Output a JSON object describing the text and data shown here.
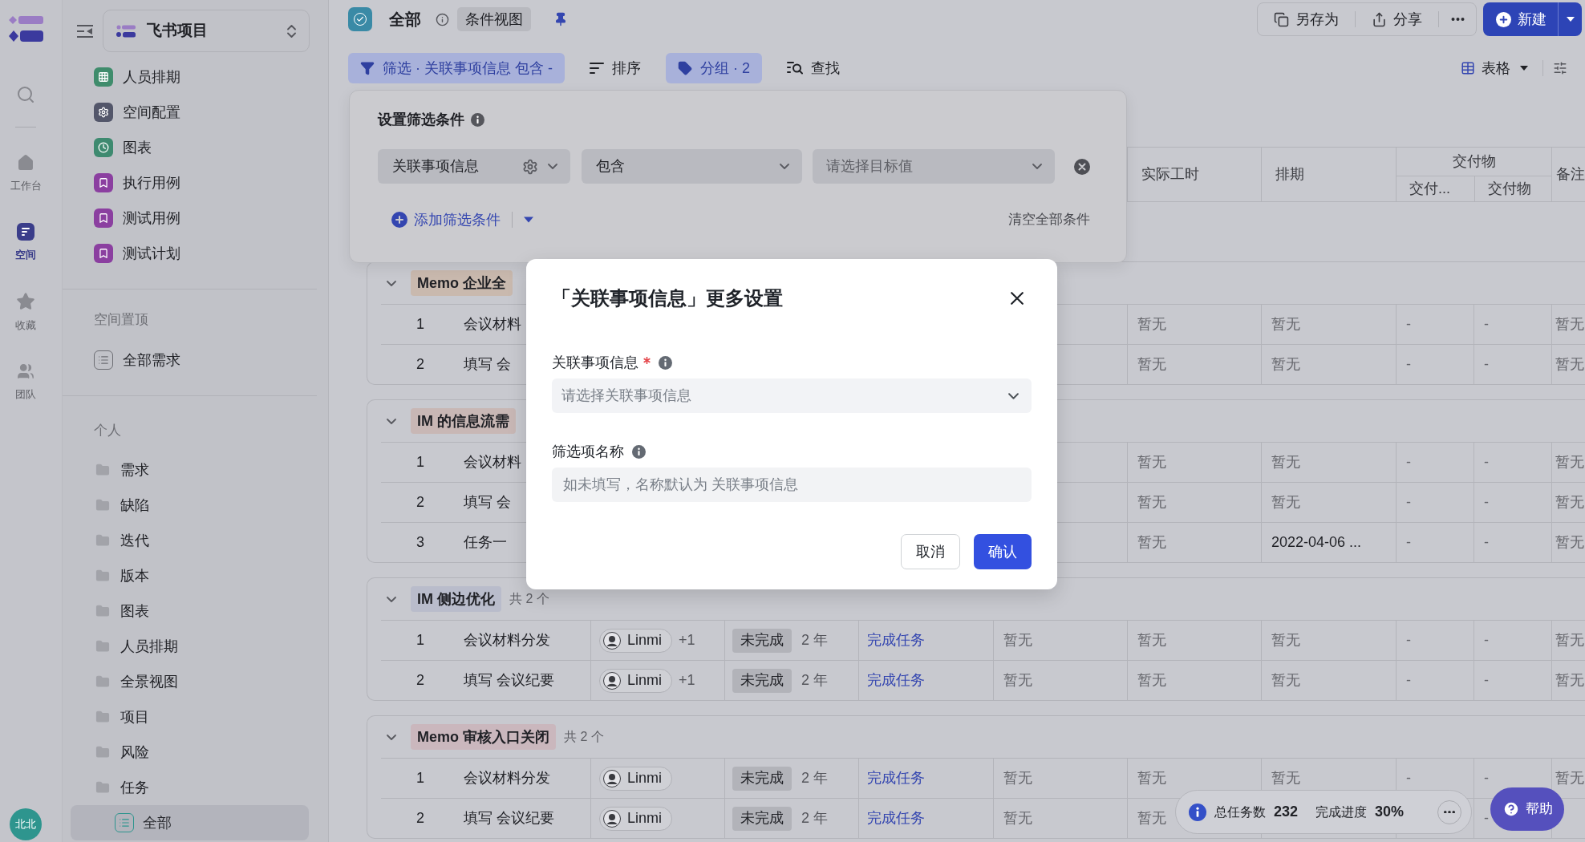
{
  "rail": {
    "items": [
      {
        "label": "工作台",
        "selected": false
      },
      {
        "label": "空间",
        "selected": true
      },
      {
        "label": "收藏",
        "selected": false
      },
      {
        "label": "团队",
        "selected": false
      }
    ],
    "avatar": "北北"
  },
  "sidebar": {
    "project": "飞书项目",
    "items": [
      {
        "label": "人员排期",
        "kind": "grid",
        "color": "#3f8c6c",
        "selected": false
      },
      {
        "label": "空间配置",
        "kind": "gear",
        "color": "#53566a",
        "selected": false
      },
      {
        "label": "图表",
        "kind": "clock",
        "color": "#3e8a70",
        "selected": false
      },
      {
        "label": "执行用例",
        "kind": "bookmark",
        "color": "#8b3fa0",
        "selected": false
      },
      {
        "label": "测试用例",
        "kind": "bookmark",
        "color": "#8b3fa0",
        "selected": false
      },
      {
        "label": "测试计划",
        "kind": "bookmark",
        "color": "#8b3fa0",
        "selected": false
      }
    ],
    "pinned": {
      "title": "空间置顶",
      "items": [
        {
          "label": "全部需求",
          "selected": false
        }
      ]
    },
    "personal": {
      "title": "个人",
      "folders": [
        {
          "label": "需求",
          "selected": false
        },
        {
          "label": "缺陷",
          "selected": false
        },
        {
          "label": "迭代",
          "selected": false
        },
        {
          "label": "版本",
          "selected": false
        },
        {
          "label": "图表",
          "selected": false
        },
        {
          "label": "人员排期",
          "selected": false
        },
        {
          "label": "全景视图",
          "selected": false
        },
        {
          "label": "项目",
          "selected": false
        },
        {
          "label": "风险",
          "selected": false
        },
        {
          "label": "任务",
          "selected": false,
          "children": [
            {
              "label": "全部",
              "selected": true
            }
          ]
        }
      ]
    }
  },
  "header": {
    "title": "全部",
    "view_tag": "条件视图",
    "actions": [
      "另存为",
      "分享"
    ],
    "new_button": "新建"
  },
  "toolbar": {
    "tools": [
      {
        "label": "筛选 · 关联事项信息 包含 -",
        "active": true
      },
      {
        "label": "排序",
        "active": false
      },
      {
        "label": "分组 · 2",
        "active": true
      },
      {
        "label": "查找",
        "active": false
      }
    ],
    "view": "表格"
  },
  "filter_panel": {
    "title": "设置筛选条件",
    "conditions": [
      {
        "field": "关联事项信息",
        "operator": "包含",
        "placeholder": "请选择目标值"
      }
    ],
    "add_label": "添加筛选条件",
    "clear_label": "清空全部条件"
  },
  "table": {
    "columns": [
      {
        "label": "实际工时"
      },
      {
        "label": "排期"
      },
      {
        "label": "交付物",
        "children": [
          {
            "label": "交付..."
          },
          {
            "label": "交付物"
          }
        ]
      },
      {
        "label": "备注"
      }
    ],
    "groups": [
      {
        "title": "Memo 企业全",
        "color": "#c9b9ae",
        "expanded": true,
        "rows": [
          {
            "index": "1",
            "title": "会议材料",
            "actual_hours": {
              "text": "暂无",
              "muted": true
            },
            "schedule": {
              "text": "暂无",
              "muted": true
            },
            "deliverables_1": {
              "text": "-",
              "muted": true
            },
            "deliverables_2": {
              "text": "-",
              "muted": true
            },
            "remarks": {
              "text": "暂无",
              "muted": true
            }
          },
          {
            "index": "2",
            "title": "填写 会",
            "actual_hours": {
              "text": "暂无",
              "muted": true
            },
            "schedule": {
              "text": "暂无",
              "muted": true
            },
            "deliverables_1": {
              "text": "-",
              "muted": true
            },
            "deliverables_2": {
              "text": "-",
              "muted": true
            },
            "remarks": {
              "text": "暂无",
              "muted": true
            }
          }
        ]
      },
      {
        "title": "IM 的信息流需",
        "color": "#c8b7b5",
        "expanded": true,
        "rows": [
          {
            "index": "1",
            "title": "会议材料",
            "actual_hours": {
              "text": "暂无",
              "muted": true
            },
            "schedule": {
              "text": "暂无",
              "muted": true
            },
            "deliverables_1": {
              "text": "-",
              "muted": true
            },
            "deliverables_2": {
              "text": "-",
              "muted": true
            },
            "remarks": {
              "text": "暂无",
              "muted": true
            }
          },
          {
            "index": "2",
            "title": "填写 会",
            "actual_hours": {
              "text": "暂无",
              "muted": true
            },
            "schedule": {
              "text": "暂无",
              "muted": true
            },
            "deliverables_1": {
              "text": "-",
              "muted": true
            },
            "deliverables_2": {
              "text": "-",
              "muted": true
            },
            "remarks": {
              "text": "暂无",
              "muted": true
            }
          },
          {
            "index": "3",
            "title": "任务一",
            "actual_hours": {
              "text": "暂无",
              "muted": true
            },
            "schedule": {
              "text": "2022-04-06 ...",
              "muted": false
            },
            "deliverables_1": {
              "text": "-",
              "muted": true
            },
            "deliverables_2": {
              "text": "-",
              "muted": true
            },
            "remarks": {
              "text": "暂无",
              "muted": true
            }
          }
        ]
      },
      {
        "title": "IM 侧边优化",
        "count": "共 2 个",
        "color": "#b9bccb",
        "expanded": true,
        "rows": [
          {
            "index": "1",
            "title": "会议材料分发",
            "assignee": "Linmi",
            "extra": "+1",
            "status": "未完成",
            "age": "2 年",
            "action": "完成任务",
            "column_6": {
              "text": "暂无",
              "muted": true
            },
            "actual_hours": {
              "text": "暂无",
              "muted": true
            },
            "schedule": {
              "text": "暂无",
              "muted": true
            },
            "deliverables_1": {
              "text": "-",
              "muted": true
            },
            "deliverables_2": {
              "text": "-",
              "muted": true
            },
            "remarks": {
              "text": "暂无",
              "muted": true
            }
          },
          {
            "index": "2",
            "title": "填写 会议纪要",
            "assignee": "Linmi",
            "extra": "+1",
            "status": "未完成",
            "age": "2 年",
            "action": "完成任务",
            "column_6": {
              "text": "暂无",
              "muted": true
            },
            "actual_hours": {
              "text": "暂无",
              "muted": true
            },
            "schedule": {
              "text": "暂无",
              "muted": true
            },
            "deliverables_1": {
              "text": "-",
              "muted": true
            },
            "deliverables_2": {
              "text": "-",
              "muted": true
            },
            "remarks": {
              "text": "暂无",
              "muted": true
            }
          }
        ]
      },
      {
        "title": "Memo 审核入口关闭",
        "count": "共 2 个",
        "color": "#cab7bd",
        "expanded": true,
        "rows": [
          {
            "index": "1",
            "title": "会议材料分发",
            "assignee": "Linmi",
            "status": "未完成",
            "age": "2 年",
            "action": "完成任务",
            "column_6": {
              "text": "暂无",
              "muted": true
            },
            "actual_hours": {
              "text": "暂无",
              "muted": true
            },
            "schedule": {
              "text": "暂无",
              "muted": true
            },
            "deliverables_1": {
              "text": "-",
              "muted": true
            },
            "deliverables_2": {
              "text": "-",
              "muted": true
            },
            "remarks": {
              "text": "暂无",
              "muted": true
            }
          },
          {
            "index": "2",
            "title": "填写 会议纪要",
            "assignee": "Linmi",
            "status": "未完成",
            "age": "2 年",
            "action": "完成任务",
            "column_6": {
              "text": "暂无",
              "muted": true
            },
            "actual_hours": {
              "text": "暂无",
              "muted": true
            },
            "deliverables_2": {
              "text": "-",
              "muted": true
            }
          }
        ]
      }
    ]
  },
  "stats": {
    "total_label": "总任务数",
    "total": "232",
    "progress_label": "完成进度",
    "progress": "30%"
  },
  "help": "帮助",
  "modal": {
    "title": "「关联事项信息」更多设置",
    "fields": [
      {
        "label": "关联事项信息",
        "required": true,
        "kind": "select",
        "placeholder": "请选择关联事项信息"
      },
      {
        "label": "筛选项名称",
        "required": false,
        "kind": "input",
        "placeholder": "如未填写，名称默认为 关联事项信息"
      }
    ],
    "buttons": [
      {
        "label": "取消",
        "primary": false
      },
      {
        "label": "确认",
        "primary": true
      }
    ]
  }
}
